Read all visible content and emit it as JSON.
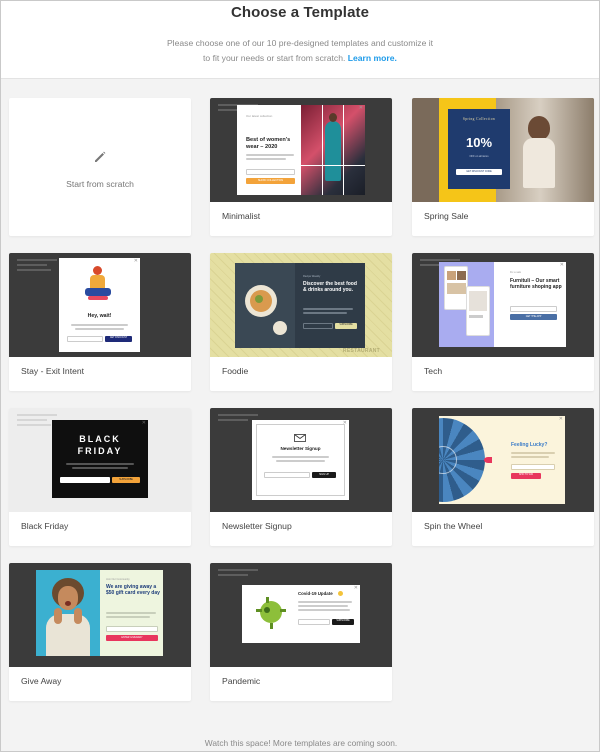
{
  "header": {
    "title": "Choose a Template",
    "subtitle_line1": "Please choose one of our 10 pre-designed templates and customize it",
    "subtitle_line2": "to fit your needs or start from scratch.",
    "learn_more": "Learn more."
  },
  "scratch": {
    "label": "Start from scratch",
    "icon": "pencil-icon"
  },
  "templates": [
    {
      "name": "Minimalist",
      "heading": "Best of women's wear – 2020",
      "eyebrow": "Our latest collection",
      "cta": "SHOW COLLECTION",
      "accent": "#f3a33a"
    },
    {
      "name": "Spring Sale",
      "heading": "Spring Collection",
      "value": "10%",
      "caption": "OFF on all items",
      "cta": "GET DISCOUNT CODE",
      "accent": "#1f3b6e",
      "frame": "#f5c518"
    },
    {
      "name": "Stay - Exit Intent",
      "heading": "Hey, wait!",
      "cta": "GET DISCOUNT",
      "accent": "#1e2a78"
    },
    {
      "name": "Foodie",
      "eyebrow": "Recipe Weekly",
      "heading": "Discover the best food & drinks around you.",
      "cta": "SUBSCRIBE",
      "brand": "RESTAURANT",
      "accent": "#e4dfa2"
    },
    {
      "name": "Tech",
      "eyebrow": "Fix a sale",
      "heading": "Furnituli – Our smart furniture shoping app",
      "cta": "GET THE APP",
      "accent": "#4a6fa5"
    },
    {
      "name": "Black Friday",
      "heading1": "BLACK",
      "heading2": "FRIDAY",
      "cta": "SUBSCRIBE",
      "accent": "#f3a33a"
    },
    {
      "name": "Newsletter Signup",
      "heading": "Newsletter Signup",
      "cta": "SIGN UP"
    },
    {
      "name": "Spin the Wheel",
      "heading": "Feeling Lucky?",
      "cta": "SPIN TO WIN",
      "accent": "#e8365d"
    },
    {
      "name": "Give Away",
      "eyebrow": "Join Our Community",
      "heading": "We are giving away a $50 gift card every day",
      "cta": "ENTER GIVEAWAY",
      "accent": "#e8365d"
    },
    {
      "name": "Pandemic",
      "heading": "Covid-19 Update",
      "cta": "SUBSCRIBE"
    }
  ],
  "footer": {
    "text": "Watch this space! More templates are coming soon."
  }
}
